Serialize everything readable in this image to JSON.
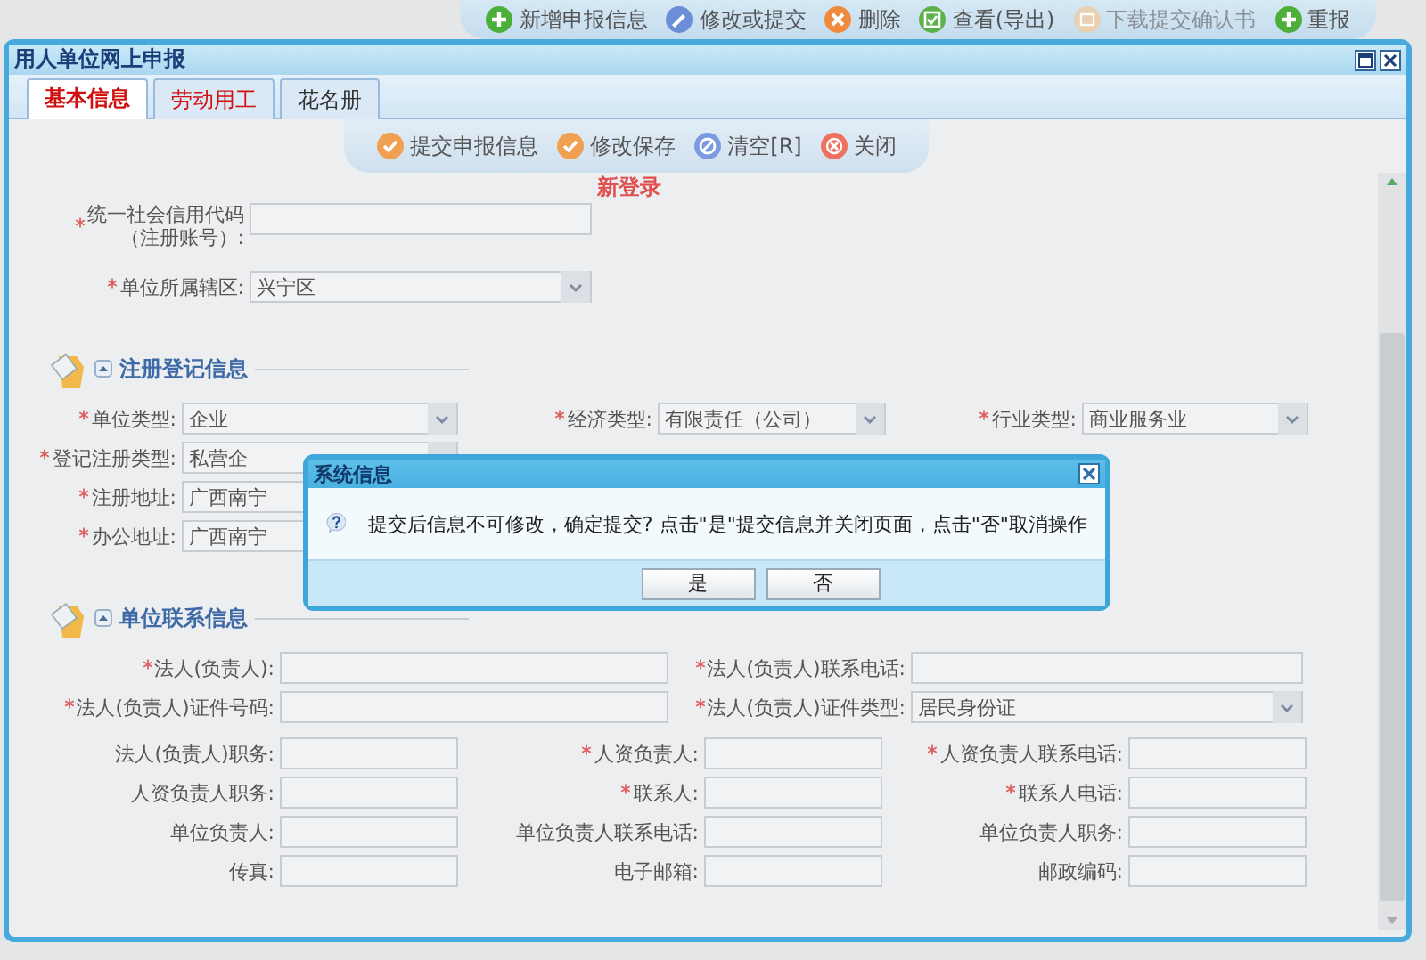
{
  "top_toolbar": [
    {
      "kind": "add",
      "label": "新增申报信息",
      "disabled": false
    },
    {
      "kind": "edit",
      "label": "修改或提交",
      "disabled": false
    },
    {
      "kind": "delete",
      "label": "删除",
      "disabled": false
    },
    {
      "kind": "view",
      "label": "查看(导出)",
      "disabled": false
    },
    {
      "kind": "download",
      "label": "下载提交确认书",
      "disabled": true
    },
    {
      "kind": "add",
      "label": "重报",
      "disabled": false
    }
  ],
  "window": {
    "title": "用人单位网上申报"
  },
  "tabs": [
    {
      "label": "基本信息",
      "selected": true,
      "color": "#d01010"
    },
    {
      "label": "劳动用工",
      "selected": false,
      "color": "#d01010"
    },
    {
      "label": "花名册",
      "selected": false,
      "color": "#333333"
    }
  ],
  "form_toolbar": [
    {
      "kind": "submit",
      "label": "提交申报信息"
    },
    {
      "kind": "submit",
      "label": "修改保存"
    },
    {
      "kind": "clear",
      "label": "清空[R]"
    },
    {
      "kind": "close",
      "label": "关闭"
    }
  ],
  "notice": "新登录",
  "top_fields": [
    {
      "label": "统一社会信用代码",
      "sublabel": "（注册账号）:",
      "required": true,
      "kind": "input"
    },
    {
      "label": "单位所属辖区:",
      "required": true,
      "kind": "select",
      "value": "兴宁区"
    }
  ],
  "sections": [
    {
      "title": "注册登记信息",
      "rows": [
        [
          {
            "label": "单位类型:",
            "required": true,
            "kind": "select",
            "value": "企业"
          },
          {
            "label": "经济类型:",
            "required": true,
            "kind": "select",
            "value": "有限责任（公司）"
          },
          {
            "label": "行业类型:",
            "required": true,
            "kind": "select",
            "value": "商业服务业"
          }
        ],
        [
          {
            "label": "登记注册类型:",
            "required": true,
            "kind": "select",
            "value": "私营企"
          }
        ],
        [
          {
            "label": "注册地址:",
            "required": true,
            "kind": "input",
            "value": "广西南宁"
          }
        ],
        [
          {
            "label": "办公地址:",
            "required": true,
            "kind": "input",
            "value": "广西南宁"
          }
        ]
      ]
    },
    {
      "title": "单位联系信息",
      "wide_rows": [
        [
          {
            "label": "法人(负责人):",
            "required": true,
            "kind": "input"
          },
          {
            "label": "法人(负责人)联系电话:",
            "required": true,
            "kind": "input"
          }
        ],
        [
          {
            "label": "法人(负责人)证件号码:",
            "required": true,
            "kind": "input"
          },
          {
            "label": "法人(负责人)证件类型:",
            "required": true,
            "kind": "select",
            "value": "居民身份证"
          }
        ]
      ],
      "rows": [
        [
          {
            "label": "法人(负责人)职务:",
            "required": false,
            "kind": "input"
          },
          {
            "label": "人资负责人:",
            "required": true,
            "kind": "input"
          },
          {
            "label": "人资负责人联系电话:",
            "required": true,
            "kind": "input"
          }
        ],
        [
          {
            "label": "人资负责人职务:",
            "required": false,
            "kind": "input"
          },
          {
            "label": "联系人:",
            "required": true,
            "kind": "input"
          },
          {
            "label": "联系人电话:",
            "required": true,
            "kind": "input"
          }
        ],
        [
          {
            "label": "单位负责人:",
            "required": false,
            "kind": "input"
          },
          {
            "label": "单位负责人联系电话:",
            "required": false,
            "kind": "input"
          },
          {
            "label": "单位负责人职务:",
            "required": false,
            "kind": "input"
          }
        ],
        [
          {
            "label": "传真:",
            "required": false,
            "kind": "input"
          },
          {
            "label": "电子邮箱:",
            "required": false,
            "kind": "input"
          },
          {
            "label": "邮政编码:",
            "required": false,
            "kind": "input"
          }
        ]
      ]
    }
  ],
  "dialog": {
    "title": "系统信息",
    "message": "提交后信息不可修改，确定提交? 点击\"是\"提交信息并关闭页面，点击\"否\"取消操作",
    "buttons": [
      "是",
      "否"
    ]
  }
}
